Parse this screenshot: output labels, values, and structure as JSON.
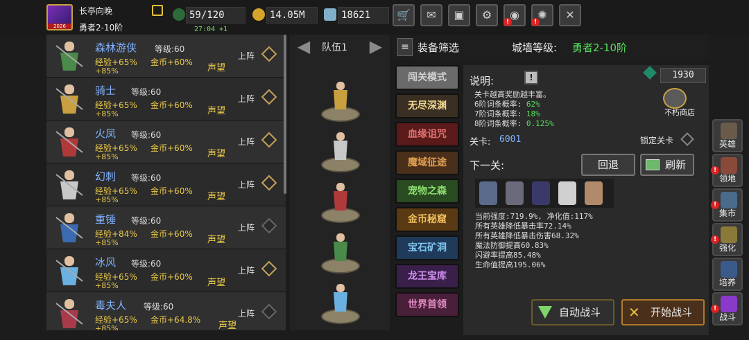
{
  "player": {
    "name": "长亭向晚",
    "rank": "勇者2-10阶",
    "avatar_level": "2026"
  },
  "resources": {
    "stamina": "59/120",
    "gold": "14.05M",
    "gems": "18621",
    "regen_timer": "27:04 +1"
  },
  "toolbar": [
    {
      "icon": "shop-cart-icon",
      "alert": false
    },
    {
      "icon": "mail-icon",
      "alert": false
    },
    {
      "icon": "gamepad-icon",
      "alert": false
    },
    {
      "icon": "gear-icon",
      "alert": false
    },
    {
      "icon": "color-wheel-icon",
      "alert": true
    },
    {
      "icon": "fireworks-icon",
      "alert": true
    },
    {
      "icon": "crossed-swords-icon",
      "alert": false
    }
  ],
  "heroes": [
    {
      "name": "森林游侠",
      "level_label": "等级:60",
      "exp": "经验+65%",
      "gold": "金币+60%",
      "extra": "+85%",
      "fame": "声望",
      "deploy": "上阵",
      "deployed": true,
      "color": "#4a8a4a"
    },
    {
      "name": "骑士",
      "level_label": "等级:60",
      "exp": "经验+65%",
      "gold": "金币+60%",
      "extra": "+85%",
      "fame": "声望",
      "deploy": "上阵",
      "deployed": true,
      "color": "#c9a040"
    },
    {
      "name": "火凤",
      "level_label": "等级:60",
      "exp": "经验+65%",
      "gold": "金币+60%",
      "extra": "+85%",
      "fame": "声望",
      "deploy": "上阵",
      "deployed": true,
      "color": "#b03a3a"
    },
    {
      "name": "幻刺",
      "level_label": "等级:60",
      "exp": "经验+65%",
      "gold": "金币+60%",
      "extra": "+85%",
      "fame": "声望",
      "deploy": "上阵",
      "deployed": true,
      "color": "#c8c8c8"
    },
    {
      "name": "重锤",
      "level_label": "等级:60",
      "exp": "经验+84%",
      "gold": "金币+60%",
      "extra": "+85%",
      "fame": "声望",
      "deploy": "上阵",
      "deployed": false,
      "color": "#3a6ab0"
    },
    {
      "name": "冰风",
      "level_label": "等级:60",
      "exp": "经验+65%",
      "gold": "金币+60%",
      "extra": "+85%",
      "fame": "声望",
      "deploy": "上阵",
      "deployed": true,
      "color": "#6ab0e0"
    },
    {
      "name": "毒夫人",
      "level_label": "等级:60",
      "exp": "经验+65%",
      "gold": "金币+64.8%",
      "extra": "+85%",
      "fame": "声望",
      "deploy": "上阵",
      "deployed": false,
      "color": "#a83a4a"
    }
  ],
  "team": {
    "label": "队伍1",
    "members": [
      "#c9a040",
      "#c8c8c8",
      "#b03a3a",
      "#4a8a4a",
      "#6ab0e0"
    ]
  },
  "equip": {
    "filter_label": "装备筛选",
    "wall_label": "城墙等级:",
    "wall_value": "勇者2-10阶"
  },
  "modes": [
    {
      "label": "闯关模式",
      "bg": "#6a6a6a",
      "fg": "#cfcfcf",
      "alert": false
    },
    {
      "label": "无尽深渊",
      "bg": "#3a2f22",
      "fg": "#f0d890",
      "alert": false
    },
    {
      "label": "血缘诅咒",
      "bg": "#5a1a1a",
      "fg": "#e07070",
      "alert": true
    },
    {
      "label": "魔域征途",
      "bg": "#4a2f1a",
      "fg": "#e0a050",
      "alert": false
    },
    {
      "label": "宠物之森",
      "bg": "#2a4a22",
      "fg": "#8ee070",
      "alert": false
    },
    {
      "label": "金币秘窟",
      "bg": "#5a3a12",
      "fg": "#f0c060",
      "alert": false
    },
    {
      "label": "宝石矿洞",
      "bg": "#1f3a5a",
      "fg": "#80c8f0",
      "alert": false
    },
    {
      "label": "龙王宝库",
      "bg": "#3a1f4a",
      "fg": "#d090f0",
      "alert": false
    },
    {
      "label": "世界首领",
      "bg": "#4a1f3a",
      "fg": "#e08ac0",
      "alert": false
    }
  ],
  "detail": {
    "title": "说明:",
    "gem_count": "1930",
    "shop_label": "不朽商店",
    "lines": [
      {
        "text": "关卡越高奖励越丰富。",
        "value": ""
      },
      {
        "text": "6阶词条概率: ",
        "value": "62%"
      },
      {
        "text": "7阶词条概率: ",
        "value": "18%"
      },
      {
        "text": "8阶词条概率: ",
        "value": "0.125%"
      }
    ],
    "level_label": "关卡:",
    "level_value": "6001",
    "lock_label": "锁定关卡",
    "next_label": "下一关:",
    "back_label": "回退",
    "refresh_label": "刷新",
    "enemy_colors": [
      "#5a6a8a",
      "#6a6a7a",
      "#3a3a6a",
      "#d0d0d0",
      "#b08a6a"
    ],
    "modifiers": [
      "当前强度:719.9%, 净化值:117%",
      "所有英雄降低暴击率72.14%",
      "所有英雄降低暴击伤害68.32%",
      "魔法防御提高60.83%",
      "闪避率提高85.48%",
      "生命值提高195.06%"
    ],
    "auto_label": "自动战斗",
    "start_label": "开始战斗"
  },
  "sidenav": [
    {
      "label": "英雄",
      "alert": false,
      "color": "#6a5a4a"
    },
    {
      "label": "领地",
      "alert": true,
      "color": "#8a4a3a"
    },
    {
      "label": "集市",
      "alert": true,
      "color": "#4a6a8a"
    },
    {
      "label": "强化",
      "alert": true,
      "color": "#8a7a3a"
    },
    {
      "label": "培养",
      "alert": false,
      "color": "#3a5a8a"
    },
    {
      "label": "战斗",
      "alert": true,
      "color": "#8a3ac8"
    }
  ]
}
